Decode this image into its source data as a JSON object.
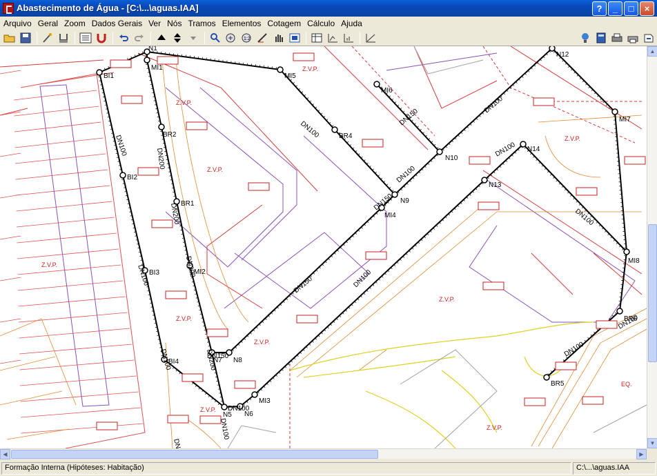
{
  "window": {
    "title": "Abastecimento de Água - [C:\\...\\aguas.IAA]",
    "buttons": [
      "?",
      "_",
      "□",
      "×"
    ]
  },
  "menu": [
    "Arquivo",
    "Geral",
    "Zoom",
    "Dados Gerais",
    "Ver",
    "Nós",
    "Tramos",
    "Elementos",
    "Cotagem",
    "Cálculo",
    "Ajuda"
  ],
  "toolbar": {
    "left_icons": [
      "open-folder-icon",
      "save-disk-icon",
      "tool-wand-icon",
      "brush-icon",
      "network-icon",
      "magnet-icon",
      "undo-icon",
      "redo-icon",
      "arrow-up-icon",
      "arrow-updown-icon",
      "dropdown-icon"
    ],
    "right_icons": [
      "pointer-icon",
      "zoom-in-icon",
      "zoom-window-icon",
      "draw-icon",
      "pan-hand-icon",
      "layers-icon",
      "table-icon",
      "axis-icon",
      "profile-icon",
      "graph-icon"
    ],
    "far_right_icons": [
      "lamp-icon",
      "calculator-icon",
      "print-icon",
      "printer2-icon",
      "export-icon"
    ]
  },
  "map": {
    "nodes": [
      {
        "id": "BI1"
      },
      {
        "id": "MI1"
      },
      {
        "id": "BR2"
      },
      {
        "id": "BI2"
      },
      {
        "id": "BR1"
      },
      {
        "id": "MI2"
      },
      {
        "id": "BI3"
      },
      {
        "id": "BI4"
      },
      {
        "id": "N7"
      },
      {
        "id": "N8"
      },
      {
        "id": "N5"
      },
      {
        "id": "N6"
      },
      {
        "id": "MI3"
      },
      {
        "id": "MI4"
      },
      {
        "id": "N9"
      },
      {
        "id": "N10"
      },
      {
        "id": "N13"
      },
      {
        "id": "N14"
      },
      {
        "id": "MI5"
      },
      {
        "id": "MI6"
      },
      {
        "id": "BR4"
      },
      {
        "id": "N12"
      },
      {
        "id": "MI7"
      },
      {
        "id": "BR5"
      },
      {
        "id": "BR6"
      },
      {
        "id": "MI8"
      },
      {
        "id": "N1"
      }
    ],
    "pipe_labels": [
      "DN100",
      "DN200",
      "DN200",
      "DN200",
      "DN100",
      "DN100",
      "DN100",
      "DN200",
      "DN100",
      "DN150",
      "DN150",
      "DN100",
      "DN100",
      "DN150",
      "DN100",
      "DN150",
      "DN100",
      "DN100",
      "DN100",
      "DN100",
      "DN100",
      "DN100",
      "DN300"
    ],
    "zone_labels": [
      "Z.V.P.",
      "Z.V.P.",
      "Z.V.P.",
      "Z.V.P.",
      "Z.V.P.",
      "Z.V.P.",
      "Z.V.P.",
      "Z.V.P.",
      "EQ.",
      "Z.V.P.",
      "Z.V.P."
    ]
  },
  "statusbar": {
    "left": "Formação Interna (Hipóteses: Habitação)",
    "right": "C:\\...\\aguas.IAA"
  }
}
